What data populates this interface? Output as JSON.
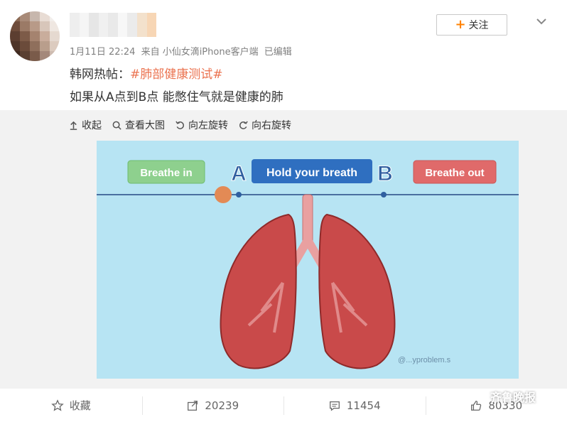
{
  "header": {
    "follow_label": "关注",
    "meta": {
      "date": "1月11日 22:24",
      "source": "来自 小仙女滴iPhone客户端",
      "edited": "已编辑"
    },
    "post": {
      "prefix": "韩网热帖：",
      "hashtag": "#肺部健康测试#",
      "body": "如果从A点到B点 能憋住气就是健康的肺"
    }
  },
  "toolbar": {
    "collapse_label": "收起",
    "view_large_label": "查看大图",
    "rotate_left_label": "向左旋转",
    "rotate_right_label": "向右旋转"
  },
  "image": {
    "breathe_in": "Breathe in",
    "point_a": "A",
    "hold": "Hold your breath",
    "point_b": "B",
    "breathe_out": "Breathe out",
    "credit": "@...yproblem.s"
  },
  "footer": {
    "favorite_label": "收藏",
    "repost_count": "20239",
    "comment_count": "11454",
    "like_count": "80330"
  },
  "watermark": {
    "text": "齐鲁晚报"
  },
  "colors": {
    "accent": "#ff8200",
    "hashtag": "#eb7350",
    "image_bg": "#b7e4f3",
    "lung": "#c94a4a",
    "hold_box": "#2f6fc0",
    "breathe_in_box": "#8ed08e",
    "breathe_out_box": "#e06a6a"
  }
}
